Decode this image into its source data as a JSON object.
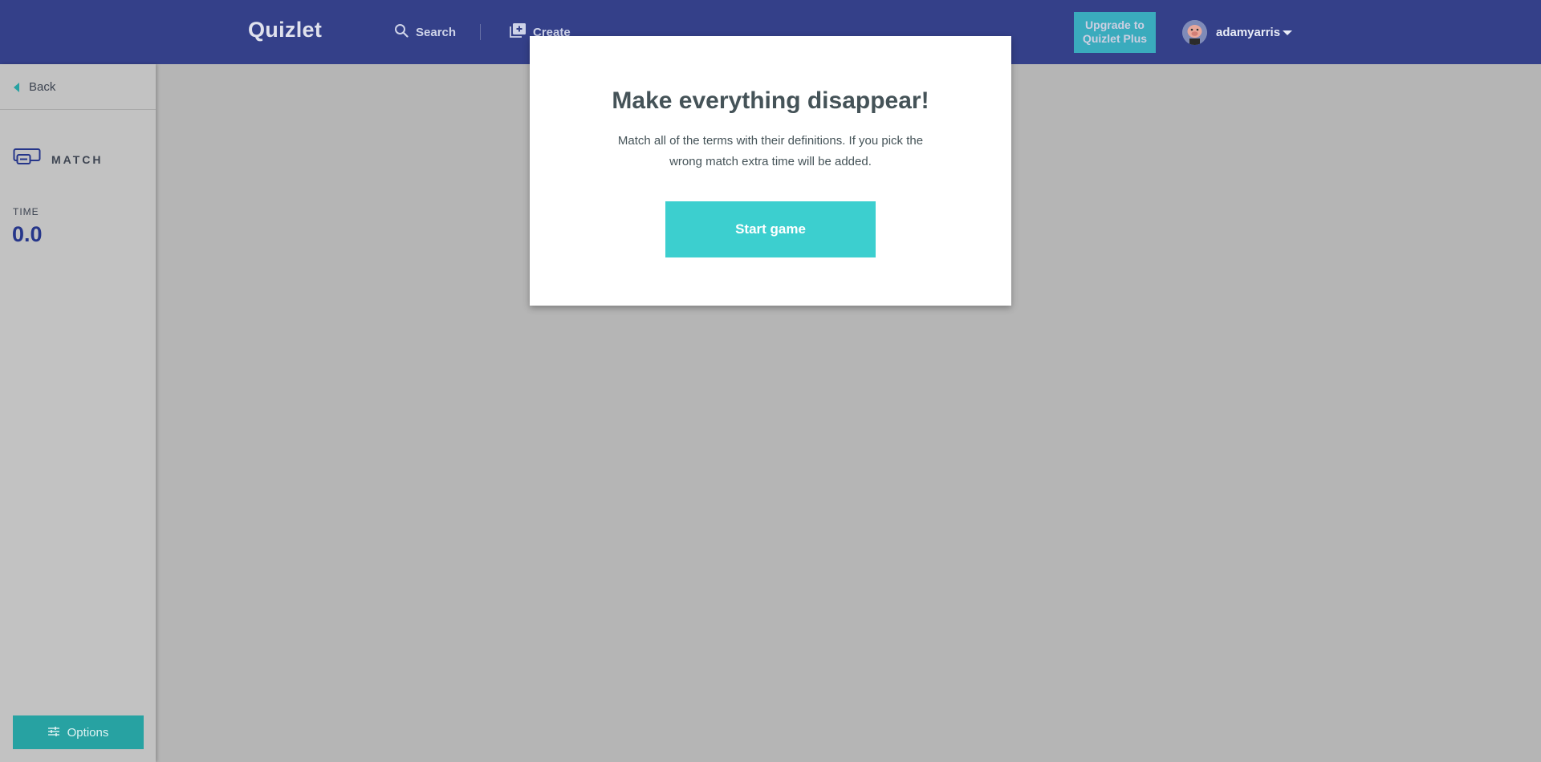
{
  "header": {
    "logo": "Quizlet",
    "search_label": "Search",
    "create_label": "Create",
    "upgrade_line1": "Upgrade to",
    "upgrade_line2": "Quizlet Plus",
    "username": "adamyarris"
  },
  "sidebar": {
    "back_label": "Back",
    "mode_label": "MATCH",
    "time_label": "TIME",
    "time_value": "0.0",
    "options_label": "Options"
  },
  "modal": {
    "title": "Make everything disappear!",
    "description": "Match all of the terms with their definitions. If you pick the wrong match extra time will be added.",
    "start_label": "Start game"
  },
  "colors": {
    "header_bg": "#344089",
    "accent": "#3ccfcf",
    "accent_dark": "#27a2a2",
    "time_color": "#26368a",
    "overlay": "#b5b5b5"
  },
  "icons": [
    "search-icon",
    "create-icon",
    "match-icon",
    "options-icon",
    "back-caret-icon",
    "dropdown-caret-icon"
  ]
}
